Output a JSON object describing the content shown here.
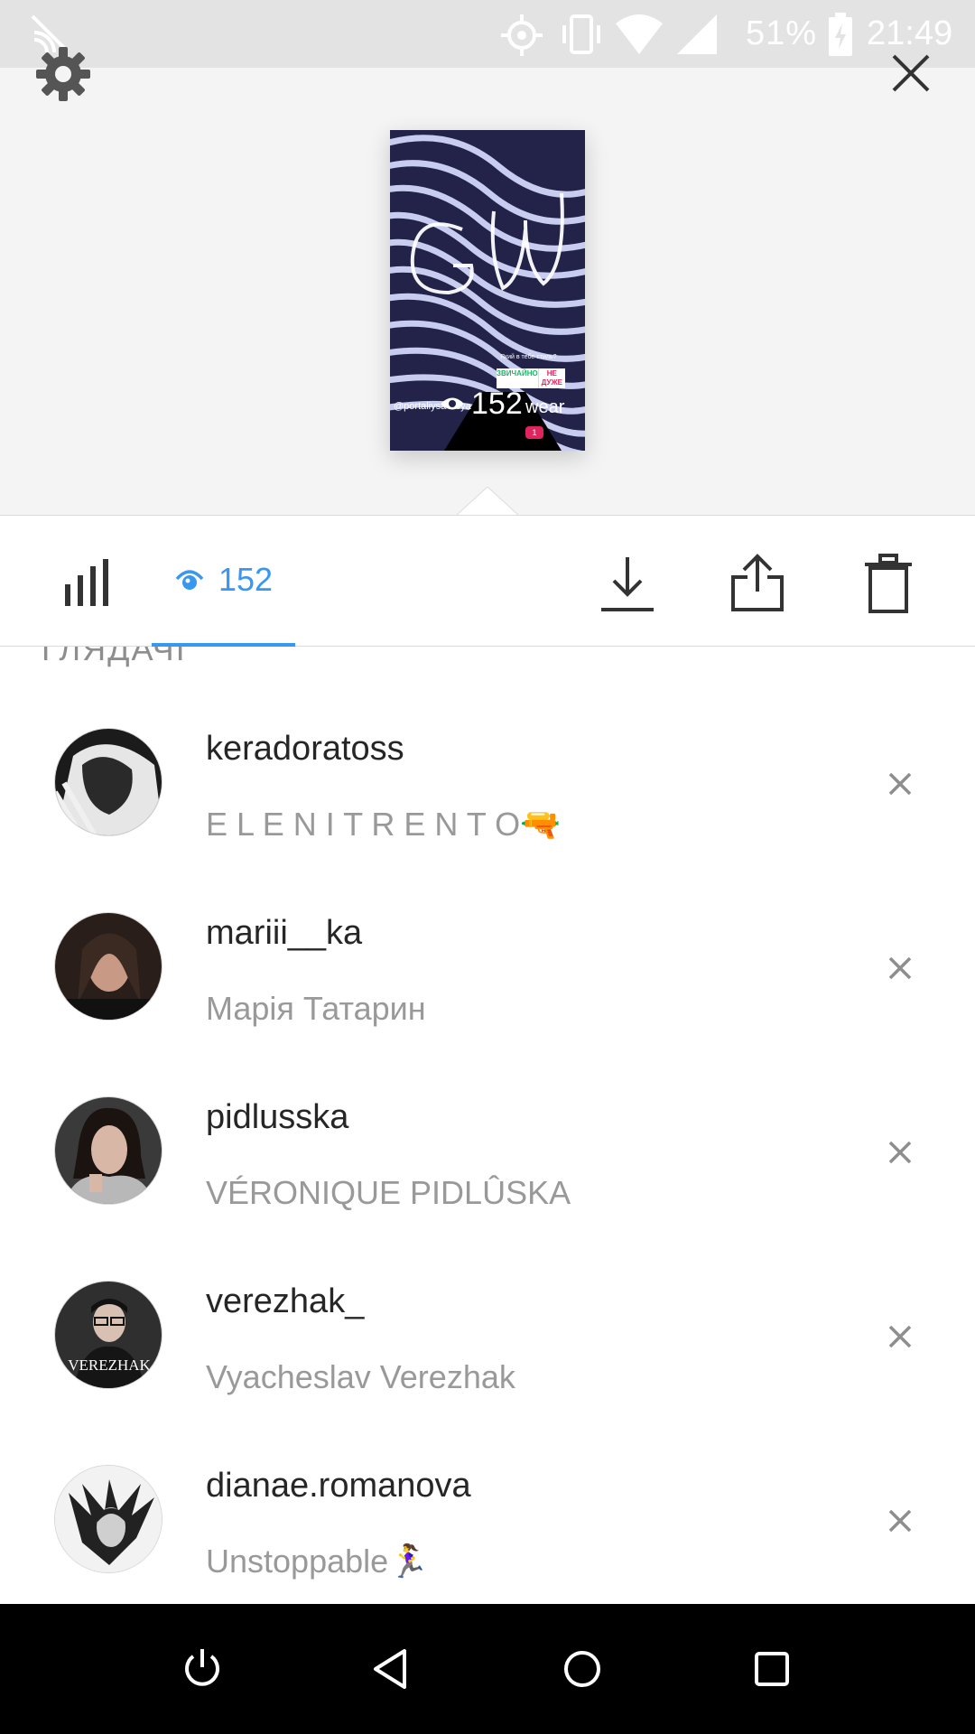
{
  "status_bar": {
    "battery_percent": "51%",
    "time": "21:49",
    "icons": [
      "cast-off-icon",
      "location-icon",
      "vibrate-icon",
      "wifi-icon",
      "signal-icon",
      "battery-charging-icon"
    ]
  },
  "header": {
    "icons": [
      "gear-icon",
      "close-icon"
    ],
    "story_thumbnail": {
      "views_overlay": "152",
      "question": "Який в тебе стиль?",
      "poll_option_1": "ЗВИЧАЙНО",
      "poll_option_2": "НЕ ДУЖЕ",
      "handle": "@portaliysa Vsya",
      "brand": "wear",
      "heart_count": "1"
    }
  },
  "toolbar": {
    "viewers_count": "152",
    "accent_color": "#3897f0",
    "icons": [
      "bar-chart-icon",
      "eye-icon",
      "download-icon",
      "share-icon",
      "trash-icon"
    ]
  },
  "viewers": {
    "section_label": "ГЛЯДАЧІ",
    "items": [
      {
        "username": "keradoratoss",
        "full_name": "E L E N I   T R E N T O🔫"
      },
      {
        "username": "mariii__ka",
        "full_name": "Марія Татарин"
      },
      {
        "username": "pidlusska",
        "full_name": "VÉRONIQUE PIDLÛSKA"
      },
      {
        "username": "verezhak_",
        "full_name": "Vyacheslav Verezhak",
        "avatar_text": "VEREZHAK"
      },
      {
        "username": "dianae.romanova",
        "full_name": "Unstoppable🏃‍♀"
      }
    ]
  },
  "nav_bar": {
    "icons": [
      "power-icon",
      "back-icon",
      "home-icon",
      "recents-icon"
    ]
  }
}
